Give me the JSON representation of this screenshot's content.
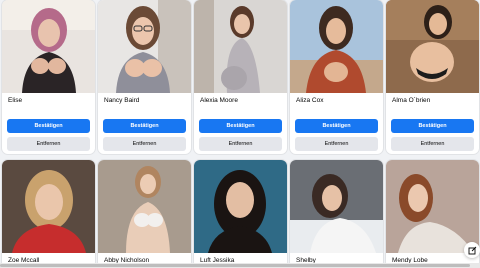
{
  "colors": {
    "confirm_bg": "#1877f2",
    "remove_bg": "#e4e6eb",
    "page_bg": "#f0f2f5"
  },
  "buttons": {
    "confirm_label": "Bestätigen",
    "remove_label": "Entfernen"
  },
  "requests": [
    {
      "name": "Elise",
      "photo_icon": "profile-photo"
    },
    {
      "name": "Nancy Baird",
      "photo_icon": "profile-photo"
    },
    {
      "name": "Alexia Moore",
      "photo_icon": "profile-photo"
    },
    {
      "name": "Aliza Cox",
      "photo_icon": "profile-photo"
    },
    {
      "name": "Alma O´brien",
      "photo_icon": "profile-photo"
    },
    {
      "name": "Zoe Mccall",
      "photo_icon": "profile-photo"
    },
    {
      "name": "Abby Nicholson",
      "photo_icon": "profile-photo"
    },
    {
      "name": "Luft Jessika",
      "photo_icon": "profile-photo"
    },
    {
      "name": "Shelby",
      "photo_icon": "profile-photo"
    },
    {
      "name": "Mendy Lobe",
      "photo_icon": "profile-photo"
    }
  ],
  "corner_action_icon": "edit-icon"
}
